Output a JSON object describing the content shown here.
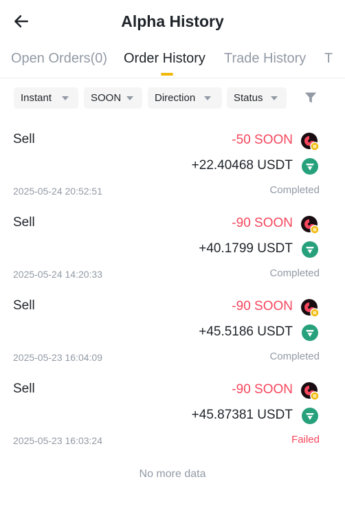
{
  "header": {
    "title": "Alpha History"
  },
  "tabs": [
    {
      "label": "Open Orders(0)"
    },
    {
      "label": "Order History"
    },
    {
      "label": "Trade History"
    },
    {
      "label": "T"
    }
  ],
  "filters": [
    {
      "label": "Instant"
    },
    {
      "label": "SOON"
    },
    {
      "label": "Direction"
    },
    {
      "label": "Status"
    }
  ],
  "orders": [
    {
      "side": "Sell",
      "sell_amount": "-50 SOON",
      "receive_amount": "+22.40468 USDT",
      "time": "2025-05-24 20:52:51",
      "status": "Completed"
    },
    {
      "side": "Sell",
      "sell_amount": "-90 SOON",
      "receive_amount": "+40.1799 USDT",
      "time": "2025-05-24 14:20:33",
      "status": "Completed"
    },
    {
      "side": "Sell",
      "sell_amount": "-90 SOON",
      "receive_amount": "+45.5186 USDT",
      "time": "2025-05-23 16:04:09",
      "status": "Completed"
    },
    {
      "side": "Sell",
      "sell_amount": "-90 SOON",
      "receive_amount": "+45.87381 USDT",
      "time": "2025-05-23 16:03:24",
      "status": "Failed"
    }
  ],
  "footer": {
    "no_more_text": "No more data"
  },
  "icons": {
    "back": "arrow-left-icon",
    "filter": "funnel-icon",
    "coin": "soon-coin-icon",
    "usdt": "usdt-icon"
  },
  "colors": {
    "accent": "#f0b90b",
    "negative": "#f6465d",
    "usdt": "#26a17b",
    "muted": "#929aa5",
    "text": "#1e2329"
  }
}
